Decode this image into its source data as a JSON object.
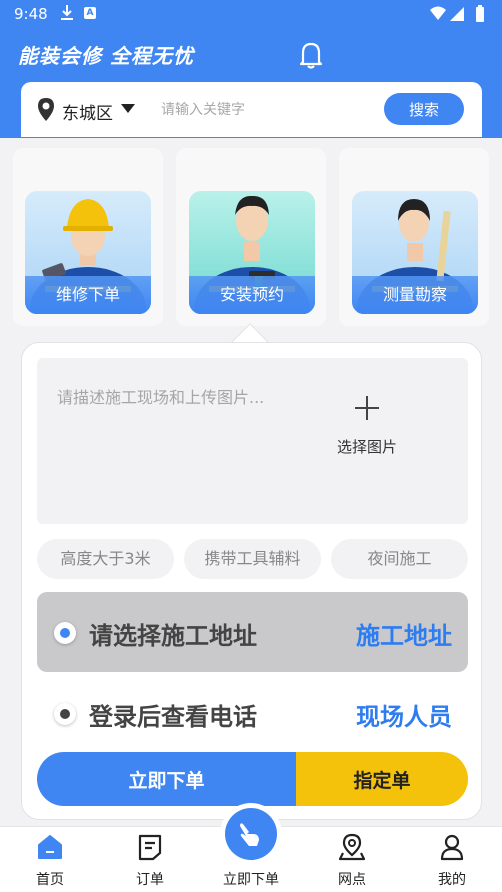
{
  "status_bar": {
    "time": "9:48"
  },
  "header": {
    "slogan": "能装会修 全程无忧",
    "bell_icon": "bell-icon"
  },
  "search": {
    "district": "东城区",
    "placeholder": "请输入关键字",
    "button_label": "搜索"
  },
  "services": [
    {
      "label": "维修下单",
      "icon": "repair-worker-image"
    },
    {
      "label": "安装预约",
      "icon": "install-worker-image"
    },
    {
      "label": "测量勘察",
      "icon": "survey-worker-image"
    }
  ],
  "form": {
    "description_placeholder": "请描述施工现场和上传图片...",
    "upload_label": "选择图片",
    "tags": [
      "高度大于3米",
      "携带工具辅料",
      "夜间施工"
    ],
    "address_prompt": "请选择施工地址",
    "address_link": "施工地址",
    "phone_prompt": "登录后查看电话",
    "phone_link": "现场人员",
    "order_button": "立即下单",
    "assign_button": "指定单"
  },
  "bottom_nav": [
    {
      "label": "首页",
      "icon": "home-icon",
      "active": true
    },
    {
      "label": "订单",
      "icon": "order-icon"
    },
    {
      "label": "立即下单",
      "icon": "tap-hand-icon"
    },
    {
      "label": "网点",
      "icon": "map-pin-icon"
    },
    {
      "label": "我的",
      "icon": "profile-icon"
    }
  ],
  "colors": {
    "primary": "#3f86f3",
    "accent": "#f5c20b",
    "muted_bg": "#f2f2f4"
  }
}
